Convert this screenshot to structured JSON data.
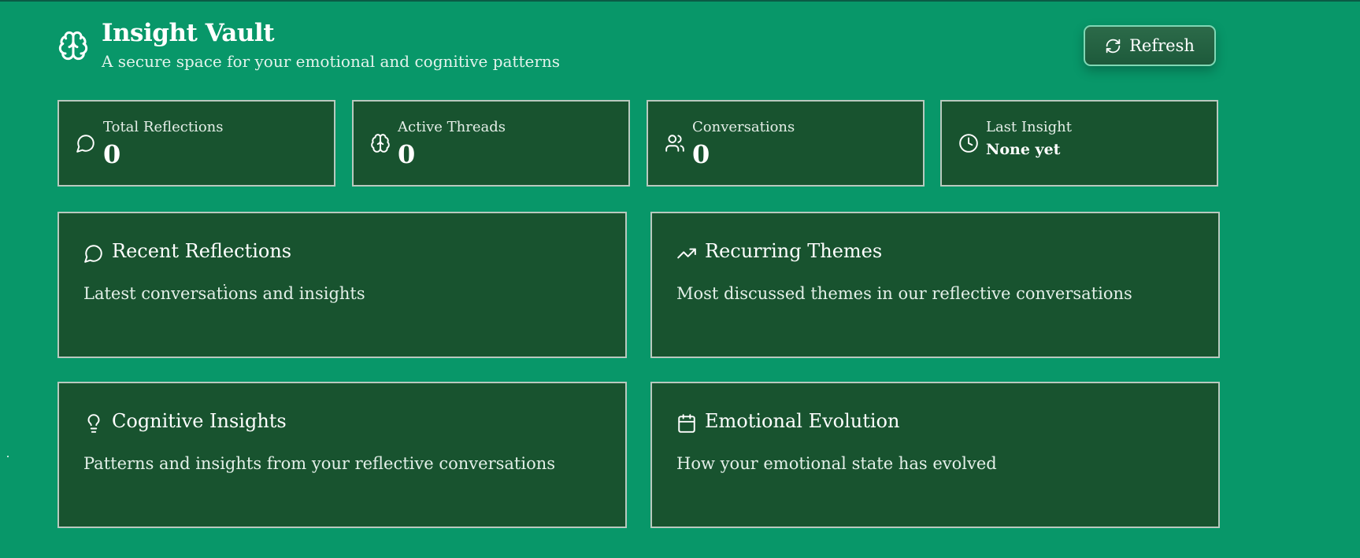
{
  "header": {
    "title": "Insight Vault",
    "subtitle": "A secure space for your emotional and cognitive patterns",
    "brand_icon": "brain-icon",
    "refresh_label": "Refresh",
    "refresh_icon": "refresh-icon"
  },
  "stats": [
    {
      "label": "Total Reflections",
      "value": "0",
      "icon": "message-circle-icon"
    },
    {
      "label": "Active Threads",
      "value": "0",
      "icon": "brain-icon"
    },
    {
      "label": "Conversations",
      "value": "0",
      "icon": "users-icon"
    },
    {
      "label": "Last Insight",
      "value": "None yet",
      "icon": "clock-icon"
    }
  ],
  "panels": [
    {
      "title": "Recent Reflections",
      "description": "Latest conversations and insights",
      "icon": "message-circle-icon"
    },
    {
      "title": "Recurring Themes",
      "description": "Most discussed themes in our reflective conversations",
      "icon": "trending-up-icon"
    },
    {
      "title": "Cognitive Insights",
      "description": "Patterns and insights from your reflective conversations",
      "icon": "lightbulb-icon"
    },
    {
      "title": "Emotional Evolution",
      "description": "How your emotional state has evolved",
      "icon": "calendar-icon"
    }
  ],
  "colors": {
    "background": "#089769",
    "card": "#18532f",
    "card_border": "#b9c9bf",
    "button_border": "#7fd7b4"
  }
}
